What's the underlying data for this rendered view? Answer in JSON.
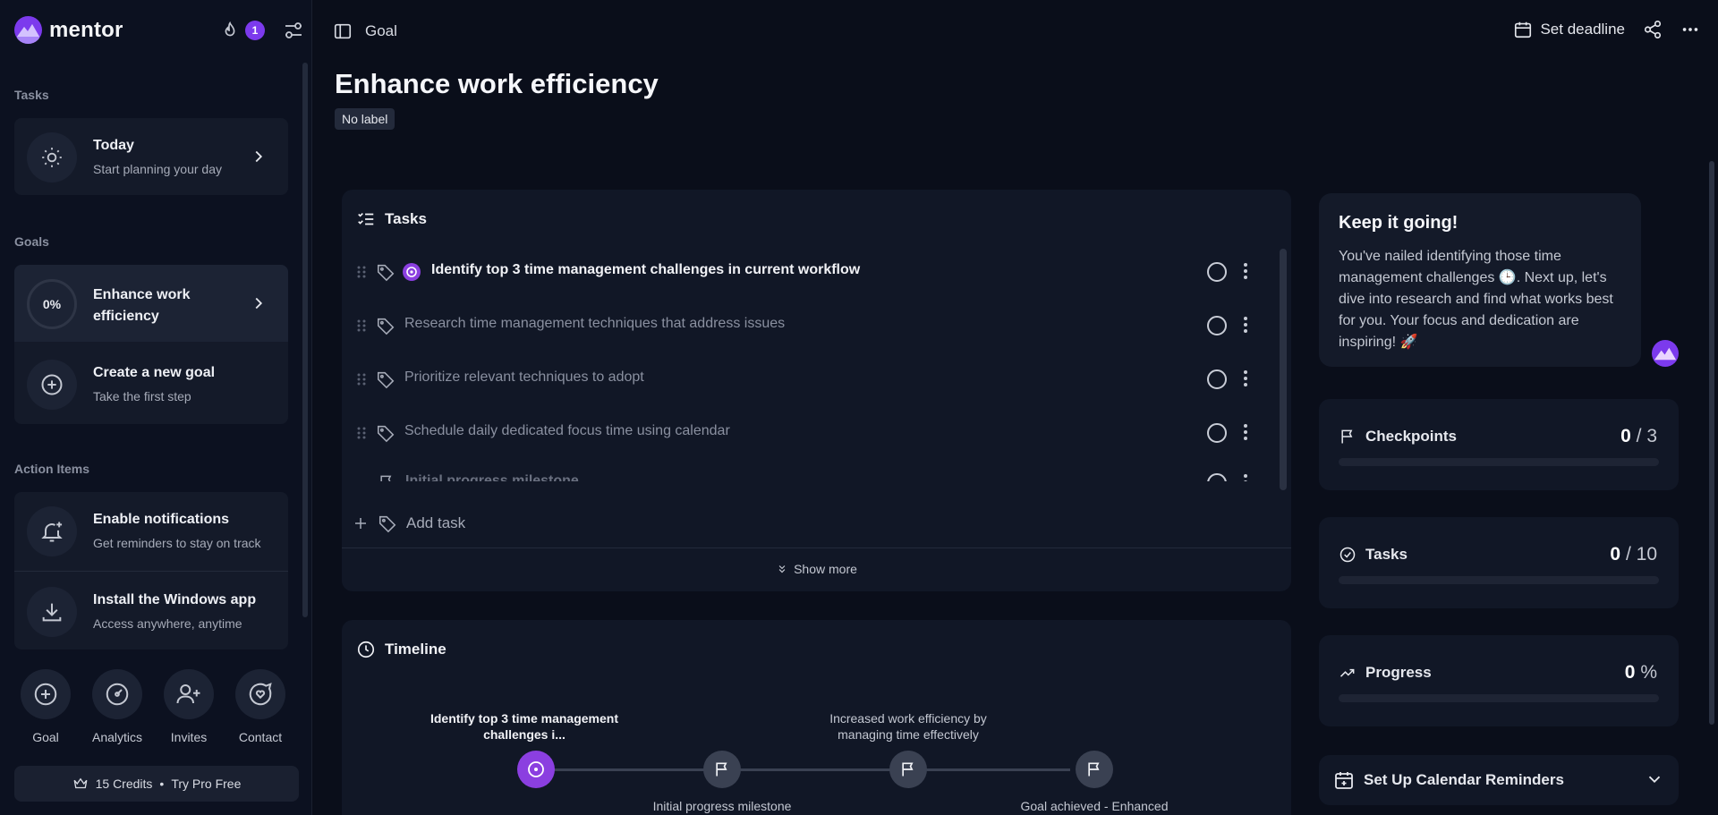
{
  "brand": {
    "name": "mentor",
    "streak_count": "1"
  },
  "sidebar": {
    "tasks_heading": "Tasks",
    "today": {
      "title": "Today",
      "subtitle": "Start planning your day"
    },
    "goals_heading": "Goals",
    "goal": {
      "progress": "0%",
      "title_line1": "Enhance work",
      "title_line2": "efficiency"
    },
    "create_goal": {
      "title": "Create a new goal",
      "subtitle": "Take the first step"
    },
    "action_heading": "Action Items",
    "notifications": {
      "title": "Enable notifications",
      "subtitle": "Get reminders to stay on track"
    },
    "install": {
      "title": "Install the Windows app",
      "subtitle": "Access anywhere, anytime"
    },
    "bottom": [
      {
        "label": "Goal",
        "icon": "plus-circle-icon"
      },
      {
        "label": "Analytics",
        "icon": "gauge-icon"
      },
      {
        "label": "Invites",
        "icon": "user-plus-icon"
      },
      {
        "label": "Contact",
        "icon": "chat-heart-icon"
      }
    ],
    "credits": "15 Credits",
    "separator": "•",
    "pro": "Try Pro Free"
  },
  "topbar": {
    "breadcrumb": "Goal",
    "set_deadline": "Set deadline"
  },
  "page": {
    "title": "Enhance work efficiency",
    "label": "No label"
  },
  "tasks_panel": {
    "heading": "Tasks",
    "items": [
      {
        "text": "Identify top 3 time management challenges in current workflow",
        "current": true
      },
      {
        "text": "Research time management techniques that address issues",
        "current": false
      },
      {
        "text": "Prioritize relevant techniques to adopt",
        "current": false
      },
      {
        "text": "Schedule daily dedicated focus time using calendar",
        "current": false
      },
      {
        "text": "Initial progress milestone",
        "current": false
      }
    ],
    "add_task": "Add task",
    "show_more": "Show more"
  },
  "timeline": {
    "heading": "Timeline",
    "top_labels": [
      "Identify top 3 time management challenges i...",
      "Increased work efficiency by managing time effectively"
    ],
    "bottom_labels": [
      "Initial progress milestone",
      "Goal achieved - Enhanced"
    ]
  },
  "coach": {
    "title": "Keep it going!",
    "message": "You've nailed identifying those time management challenges 🕒. Next up, let's dive into research and find what works best for you. Your focus and dedication are inspiring! 🚀"
  },
  "stats": {
    "checkpoints": {
      "label": "Checkpoints",
      "done": "0",
      "total": "3",
      "sep": "/"
    },
    "tasks": {
      "label": "Tasks",
      "done": "0",
      "total": "10",
      "sep": "/"
    },
    "progress": {
      "label": "Progress",
      "value": "0",
      "unit": "%",
      "fraction": 0
    }
  },
  "calendar_reminders": {
    "label": "Set Up Calendar Reminders"
  },
  "colors": {
    "accent": "#7c3aed",
    "background": "#0a0e1a",
    "card": "#141a29"
  }
}
